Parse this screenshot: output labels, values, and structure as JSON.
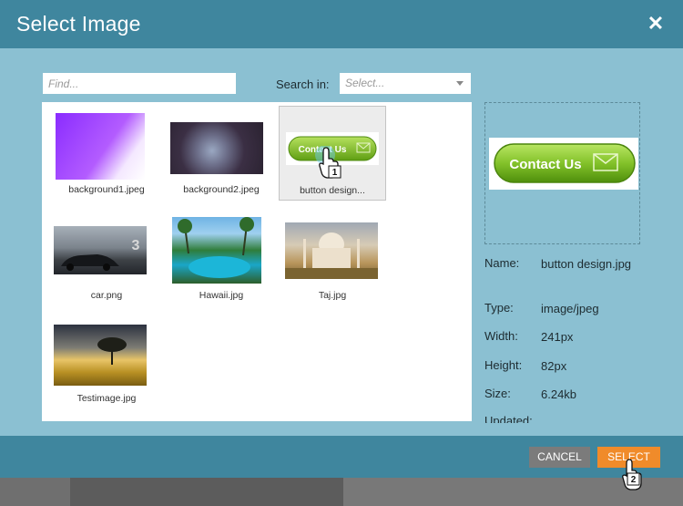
{
  "dialog": {
    "title": "Select Image",
    "close_icon": "close-icon"
  },
  "search": {
    "find_placeholder": "Find...",
    "search_in_label": "Search in:",
    "select_placeholder": "Select..."
  },
  "images": [
    {
      "name": "background1.jpeg",
      "icon": "image-thumbnail"
    },
    {
      "name": "background2.jpeg",
      "icon": "image-thumbnail"
    },
    {
      "name": "button design...",
      "icon": "image-thumbnail",
      "thumb_text": "Contact Us",
      "selected": true
    },
    {
      "name": "car.png",
      "icon": "image-thumbnail"
    },
    {
      "name": "Hawaii.jpg",
      "icon": "image-thumbnail"
    },
    {
      "name": "Taj.jpg",
      "icon": "image-thumbnail"
    },
    {
      "name": "Testimage.jpg",
      "icon": "image-thumbnail"
    }
  ],
  "preview": {
    "button_text": "Contact Us",
    "info": {
      "name_label": "Name:",
      "name_value": "button design.jpg",
      "type_label": "Type:",
      "type_value": "image/jpeg",
      "width_label": "Width:",
      "width_value": "241px",
      "height_label": "Height:",
      "height_value": "82px",
      "size_label": "Size:",
      "size_value": "6.24kb",
      "updated_label": "Updated:"
    }
  },
  "footer": {
    "cancel_label": "CANCEL",
    "select_label": "SELECT"
  },
  "cursors": [
    {
      "step": "1"
    },
    {
      "step": "2"
    }
  ],
  "colors": {
    "titlebar": "#3f869e",
    "body": "#8bc0d2",
    "select_button": "#f08b2a",
    "cancel_button": "#7b7b7b",
    "contact_button": "#7cc02a"
  }
}
